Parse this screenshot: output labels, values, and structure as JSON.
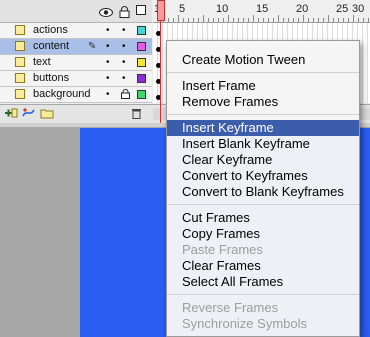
{
  "timeline": {
    "ruler": [
      "1",
      "5",
      "10",
      "15",
      "20",
      "25",
      "30"
    ],
    "layers": [
      {
        "name": "actions",
        "color": "#45d4d4",
        "selected": false,
        "locked": false,
        "editing": false
      },
      {
        "name": "content",
        "color": "#e45ee4",
        "selected": true,
        "locked": false,
        "editing": true
      },
      {
        "name": "text",
        "color": "#f2e434",
        "selected": false,
        "locked": false,
        "editing": false
      },
      {
        "name": "buttons",
        "color": "#8a2bd8",
        "selected": false,
        "locked": false,
        "editing": false
      },
      {
        "name": "background",
        "color": "#3cd86a",
        "selected": false,
        "locked": true,
        "editing": false
      }
    ]
  },
  "context_menu": {
    "items": [
      {
        "label": "Create Motion Tween",
        "enabled": true
      },
      {
        "separator": true
      },
      {
        "label": "Insert Frame",
        "enabled": true
      },
      {
        "label": "Remove Frames",
        "enabled": true
      },
      {
        "separator": true
      },
      {
        "label": "Insert Keyframe",
        "enabled": true,
        "highlighted": true
      },
      {
        "label": "Insert Blank Keyframe",
        "enabled": true
      },
      {
        "label": "Clear Keyframe",
        "enabled": true
      },
      {
        "label": "Convert to Keyframes",
        "enabled": true
      },
      {
        "label": "Convert to Blank Keyframes",
        "enabled": true
      },
      {
        "separator": true
      },
      {
        "label": "Cut Frames",
        "enabled": true
      },
      {
        "label": "Copy Frames",
        "enabled": true
      },
      {
        "label": "Paste Frames",
        "enabled": false
      },
      {
        "label": "Clear Frames",
        "enabled": true
      },
      {
        "label": "Select All Frames",
        "enabled": true
      },
      {
        "separator": true
      },
      {
        "label": "Reverse Frames",
        "enabled": false
      },
      {
        "label": "Synchronize Symbols",
        "enabled": false
      }
    ]
  },
  "colors": {
    "stage_blue": "#2a5ef2",
    "menu_highlight": "#3b5dab"
  }
}
